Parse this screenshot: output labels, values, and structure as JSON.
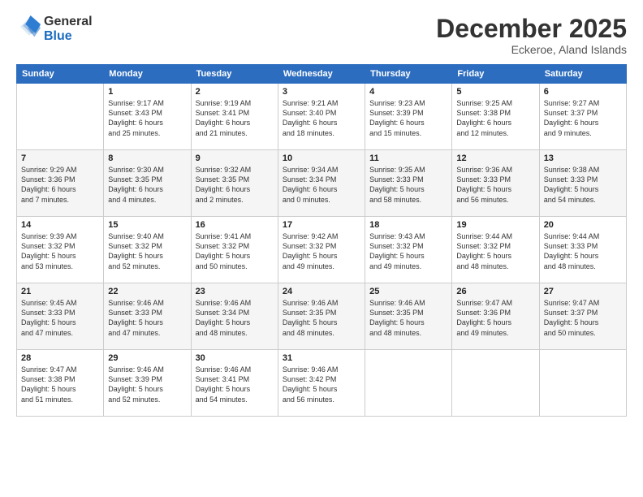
{
  "header": {
    "logo_text_general": "General",
    "logo_text_blue": "Blue",
    "month_year": "December 2025",
    "location": "Eckeroe, Aland Islands"
  },
  "calendar": {
    "days_of_week": [
      "Sunday",
      "Monday",
      "Tuesday",
      "Wednesday",
      "Thursday",
      "Friday",
      "Saturday"
    ],
    "weeks": [
      [
        {
          "day": "",
          "info": ""
        },
        {
          "day": "1",
          "info": "Sunrise: 9:17 AM\nSunset: 3:43 PM\nDaylight: 6 hours\nand 25 minutes."
        },
        {
          "day": "2",
          "info": "Sunrise: 9:19 AM\nSunset: 3:41 PM\nDaylight: 6 hours\nand 21 minutes."
        },
        {
          "day": "3",
          "info": "Sunrise: 9:21 AM\nSunset: 3:40 PM\nDaylight: 6 hours\nand 18 minutes."
        },
        {
          "day": "4",
          "info": "Sunrise: 9:23 AM\nSunset: 3:39 PM\nDaylight: 6 hours\nand 15 minutes."
        },
        {
          "day": "5",
          "info": "Sunrise: 9:25 AM\nSunset: 3:38 PM\nDaylight: 6 hours\nand 12 minutes."
        },
        {
          "day": "6",
          "info": "Sunrise: 9:27 AM\nSunset: 3:37 PM\nDaylight: 6 hours\nand 9 minutes."
        }
      ],
      [
        {
          "day": "7",
          "info": "Sunrise: 9:29 AM\nSunset: 3:36 PM\nDaylight: 6 hours\nand 7 minutes."
        },
        {
          "day": "8",
          "info": "Sunrise: 9:30 AM\nSunset: 3:35 PM\nDaylight: 6 hours\nand 4 minutes."
        },
        {
          "day": "9",
          "info": "Sunrise: 9:32 AM\nSunset: 3:35 PM\nDaylight: 6 hours\nand 2 minutes."
        },
        {
          "day": "10",
          "info": "Sunrise: 9:34 AM\nSunset: 3:34 PM\nDaylight: 6 hours\nand 0 minutes."
        },
        {
          "day": "11",
          "info": "Sunrise: 9:35 AM\nSunset: 3:33 PM\nDaylight: 5 hours\nand 58 minutes."
        },
        {
          "day": "12",
          "info": "Sunrise: 9:36 AM\nSunset: 3:33 PM\nDaylight: 5 hours\nand 56 minutes."
        },
        {
          "day": "13",
          "info": "Sunrise: 9:38 AM\nSunset: 3:33 PM\nDaylight: 5 hours\nand 54 minutes."
        }
      ],
      [
        {
          "day": "14",
          "info": "Sunrise: 9:39 AM\nSunset: 3:32 PM\nDaylight: 5 hours\nand 53 minutes."
        },
        {
          "day": "15",
          "info": "Sunrise: 9:40 AM\nSunset: 3:32 PM\nDaylight: 5 hours\nand 52 minutes."
        },
        {
          "day": "16",
          "info": "Sunrise: 9:41 AM\nSunset: 3:32 PM\nDaylight: 5 hours\nand 50 minutes."
        },
        {
          "day": "17",
          "info": "Sunrise: 9:42 AM\nSunset: 3:32 PM\nDaylight: 5 hours\nand 49 minutes."
        },
        {
          "day": "18",
          "info": "Sunrise: 9:43 AM\nSunset: 3:32 PM\nDaylight: 5 hours\nand 49 minutes."
        },
        {
          "day": "19",
          "info": "Sunrise: 9:44 AM\nSunset: 3:32 PM\nDaylight: 5 hours\nand 48 minutes."
        },
        {
          "day": "20",
          "info": "Sunrise: 9:44 AM\nSunset: 3:33 PM\nDaylight: 5 hours\nand 48 minutes."
        }
      ],
      [
        {
          "day": "21",
          "info": "Sunrise: 9:45 AM\nSunset: 3:33 PM\nDaylight: 5 hours\nand 47 minutes."
        },
        {
          "day": "22",
          "info": "Sunrise: 9:46 AM\nSunset: 3:33 PM\nDaylight: 5 hours\nand 47 minutes."
        },
        {
          "day": "23",
          "info": "Sunrise: 9:46 AM\nSunset: 3:34 PM\nDaylight: 5 hours\nand 48 minutes."
        },
        {
          "day": "24",
          "info": "Sunrise: 9:46 AM\nSunset: 3:35 PM\nDaylight: 5 hours\nand 48 minutes."
        },
        {
          "day": "25",
          "info": "Sunrise: 9:46 AM\nSunset: 3:35 PM\nDaylight: 5 hours\nand 48 minutes."
        },
        {
          "day": "26",
          "info": "Sunrise: 9:47 AM\nSunset: 3:36 PM\nDaylight: 5 hours\nand 49 minutes."
        },
        {
          "day": "27",
          "info": "Sunrise: 9:47 AM\nSunset: 3:37 PM\nDaylight: 5 hours\nand 50 minutes."
        }
      ],
      [
        {
          "day": "28",
          "info": "Sunrise: 9:47 AM\nSunset: 3:38 PM\nDaylight: 5 hours\nand 51 minutes."
        },
        {
          "day": "29",
          "info": "Sunrise: 9:46 AM\nSunset: 3:39 PM\nDaylight: 5 hours\nand 52 minutes."
        },
        {
          "day": "30",
          "info": "Sunrise: 9:46 AM\nSunset: 3:41 PM\nDaylight: 5 hours\nand 54 minutes."
        },
        {
          "day": "31",
          "info": "Sunrise: 9:46 AM\nSunset: 3:42 PM\nDaylight: 5 hours\nand 56 minutes."
        },
        {
          "day": "",
          "info": ""
        },
        {
          "day": "",
          "info": ""
        },
        {
          "day": "",
          "info": ""
        }
      ]
    ]
  }
}
